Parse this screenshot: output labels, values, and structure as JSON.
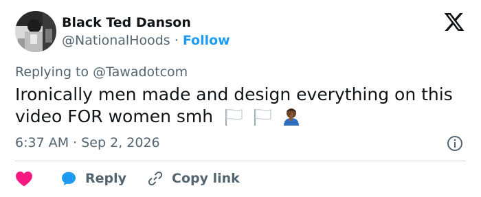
{
  "author": {
    "name": "Black Ted Danson",
    "handle": "@NationalHoods",
    "separator": "·",
    "follow_label": "Follow"
  },
  "reply_context": {
    "prefix": "Replying to",
    "mention": "@Tawadotcom"
  },
  "tweet": {
    "line1": "Ironically men made and design everything on this",
    "line2": "video FOR women smh",
    "emojis": [
      "white-flag",
      "white-flag",
      "person-facepalming"
    ]
  },
  "meta": {
    "time": "6:37 AM",
    "separator": "·",
    "date": "Sep 2, 2026"
  },
  "actions": {
    "like_icon": "heart-icon",
    "reply_label": "Reply",
    "copy_label": "Copy link"
  },
  "colors": {
    "accent": "#1d9bf0",
    "like": "#f91880",
    "secondary_text": "#536471",
    "primary_text": "#0f1419",
    "divider": "#cfd9de"
  }
}
